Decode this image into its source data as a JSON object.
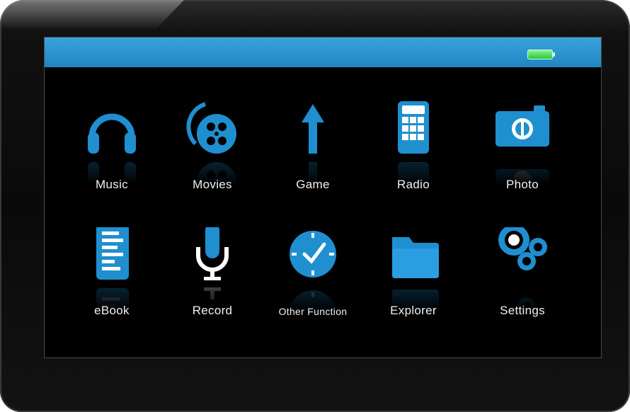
{
  "screen": {
    "battery_icon": "battery-full-icon",
    "accent_color": "#1f8fd0"
  },
  "apps": [
    {
      "label": "Music",
      "icon": "headphones-icon"
    },
    {
      "label": "Movies",
      "icon": "film-reel-icon"
    },
    {
      "label": "Game",
      "icon": "arrow-up-icon"
    },
    {
      "label": "Radio",
      "icon": "calculator-radio-icon"
    },
    {
      "label": "Photo",
      "icon": "camera-icon"
    },
    {
      "label": "eBook",
      "icon": "document-icon"
    },
    {
      "label": "Record",
      "icon": "microphone-icon"
    },
    {
      "label": "Other Function",
      "icon": "clock-icon"
    },
    {
      "label": "Explorer",
      "icon": "folder-icon"
    },
    {
      "label": "Settings",
      "icon": "gears-icon"
    }
  ]
}
